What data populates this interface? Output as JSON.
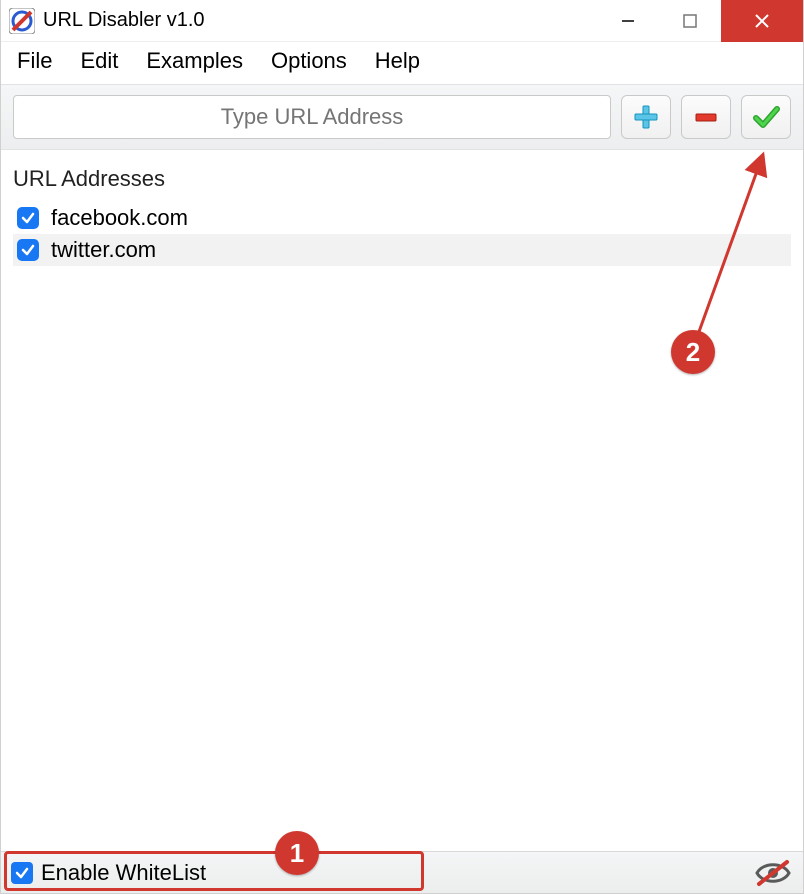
{
  "window": {
    "title": "URL Disabler v1.0"
  },
  "menu": {
    "items": [
      "File",
      "Edit",
      "Examples",
      "Options",
      "Help"
    ]
  },
  "toolbar": {
    "url_placeholder": "Type URL Address"
  },
  "list": {
    "header": "URL Addresses",
    "rows": [
      {
        "url": "facebook.com",
        "checked": true,
        "selected": false
      },
      {
        "url": "twitter.com",
        "checked": true,
        "selected": true
      }
    ]
  },
  "status": {
    "enable_whitelist_label": "Enable WhiteList",
    "enable_whitelist_checked": true
  },
  "annotations": {
    "callout1": "1",
    "callout2": "2"
  }
}
